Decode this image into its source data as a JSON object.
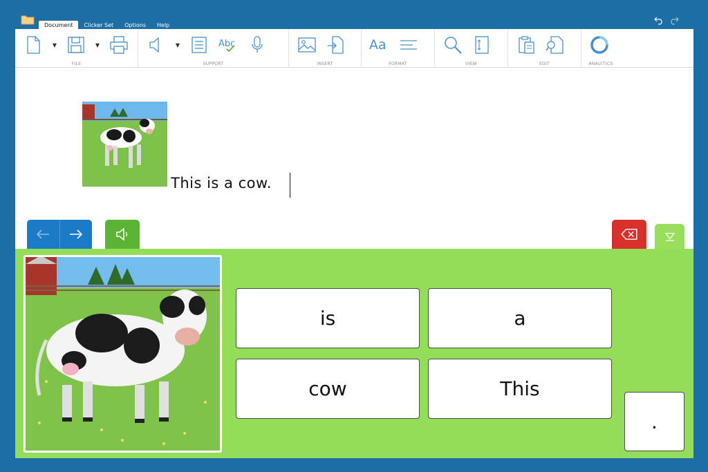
{
  "menu": {
    "tabs": [
      "Document",
      "Clicker Set",
      "Options",
      "Help"
    ],
    "active": "Document"
  },
  "ribbon": {
    "groups": [
      {
        "label": "FILE",
        "tools": [
          "new-document-icon",
          "save-icon",
          "print-icon"
        ]
      },
      {
        "label": "SUPPORT",
        "tools": [
          "speaker-icon",
          "word-list-icon",
          "spellcheck-icon",
          "microphone-icon"
        ]
      },
      {
        "label": "INSERT",
        "tools": [
          "insert-picture-icon",
          "insert-file-icon"
        ]
      },
      {
        "label": "FORMAT",
        "tools": [
          "font-icon",
          "paragraph-align-icon"
        ]
      },
      {
        "label": "VIEW",
        "tools": [
          "zoom-icon",
          "page-size-icon"
        ]
      },
      {
        "label": "EDIT",
        "tools": [
          "paste-icon",
          "find-icon"
        ]
      },
      {
        "label": "ANALYTICS",
        "tools": [
          "analytics-chart-icon"
        ]
      }
    ],
    "spellcheck_text": "Abc",
    "font_text": "Aa"
  },
  "document": {
    "text": "This is a cow."
  },
  "grid": {
    "cells": {
      "is": "is",
      "a": "a",
      "cow": "cow",
      "this": "This",
      "period": "."
    }
  },
  "colors": {
    "frame": "#1e6ea6",
    "nav": "#1b7bc7",
    "speak": "#5ab332",
    "delete": "#d8312b",
    "grid": "#93dd5a"
  }
}
